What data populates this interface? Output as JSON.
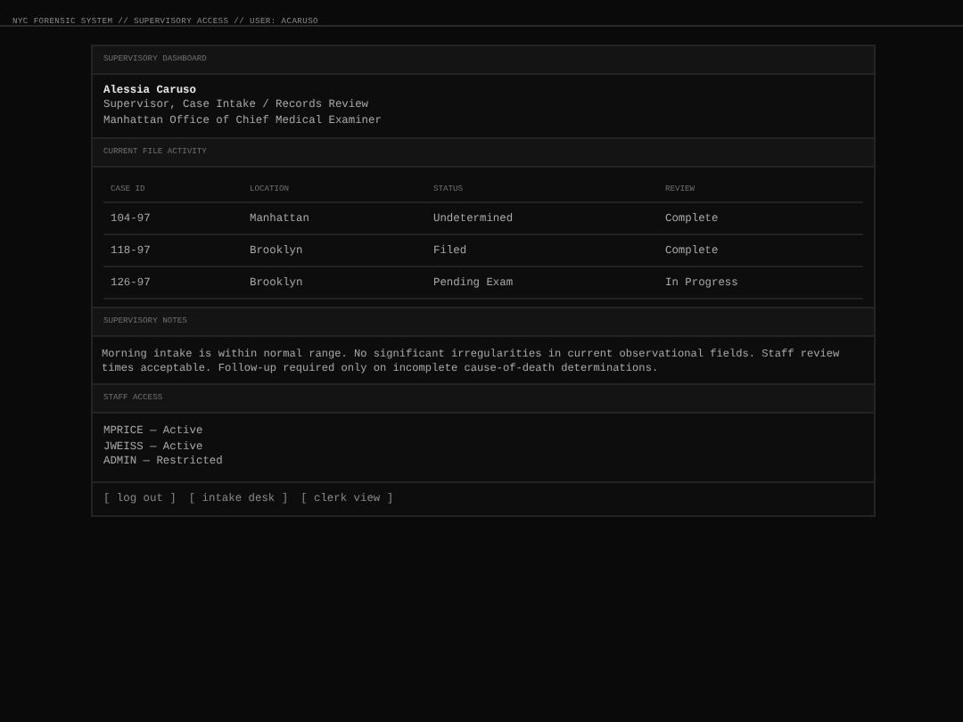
{
  "top_bar": {
    "title": "NYC FORENSIC SYSTEM // SUPERVISORY ACCESS // USER: ACARUSO"
  },
  "dashboard": {
    "heading": "SUPERVISORY DASHBOARD",
    "name": "Alessia Caruso",
    "role": "Supervisor, Case Intake / Records Review",
    "office": "Manhattan Office of Chief Medical Examiner"
  },
  "file_activity": {
    "heading": "CURRENT FILE ACTIVITY",
    "columns": [
      "CASE ID",
      "LOCATION",
      "STATUS",
      "REVIEW"
    ],
    "rows": [
      [
        "104-97",
        "Manhattan",
        "Undetermined",
        "Complete"
      ],
      [
        "118-97",
        "Brooklyn",
        "Filed",
        "Complete"
      ],
      [
        "126-97",
        "Brooklyn",
        "Pending Exam",
        "In Progress"
      ]
    ]
  },
  "notes": {
    "heading": "SUPERVISORY NOTES",
    "text": "Morning intake is within normal range. No significant irregularities in current observational fields. Staff review times acceptable. Follow-up required only on incomplete cause-of-death determinations."
  },
  "staff_access": {
    "heading": "STAFF ACCESS",
    "entries": [
      "MPRICE — Active",
      "JWEISS — Active",
      "ADMIN — Restricted"
    ]
  },
  "links": [
    "[ log out ]",
    "[ intake desk ]",
    "[ clerk view ]"
  ]
}
